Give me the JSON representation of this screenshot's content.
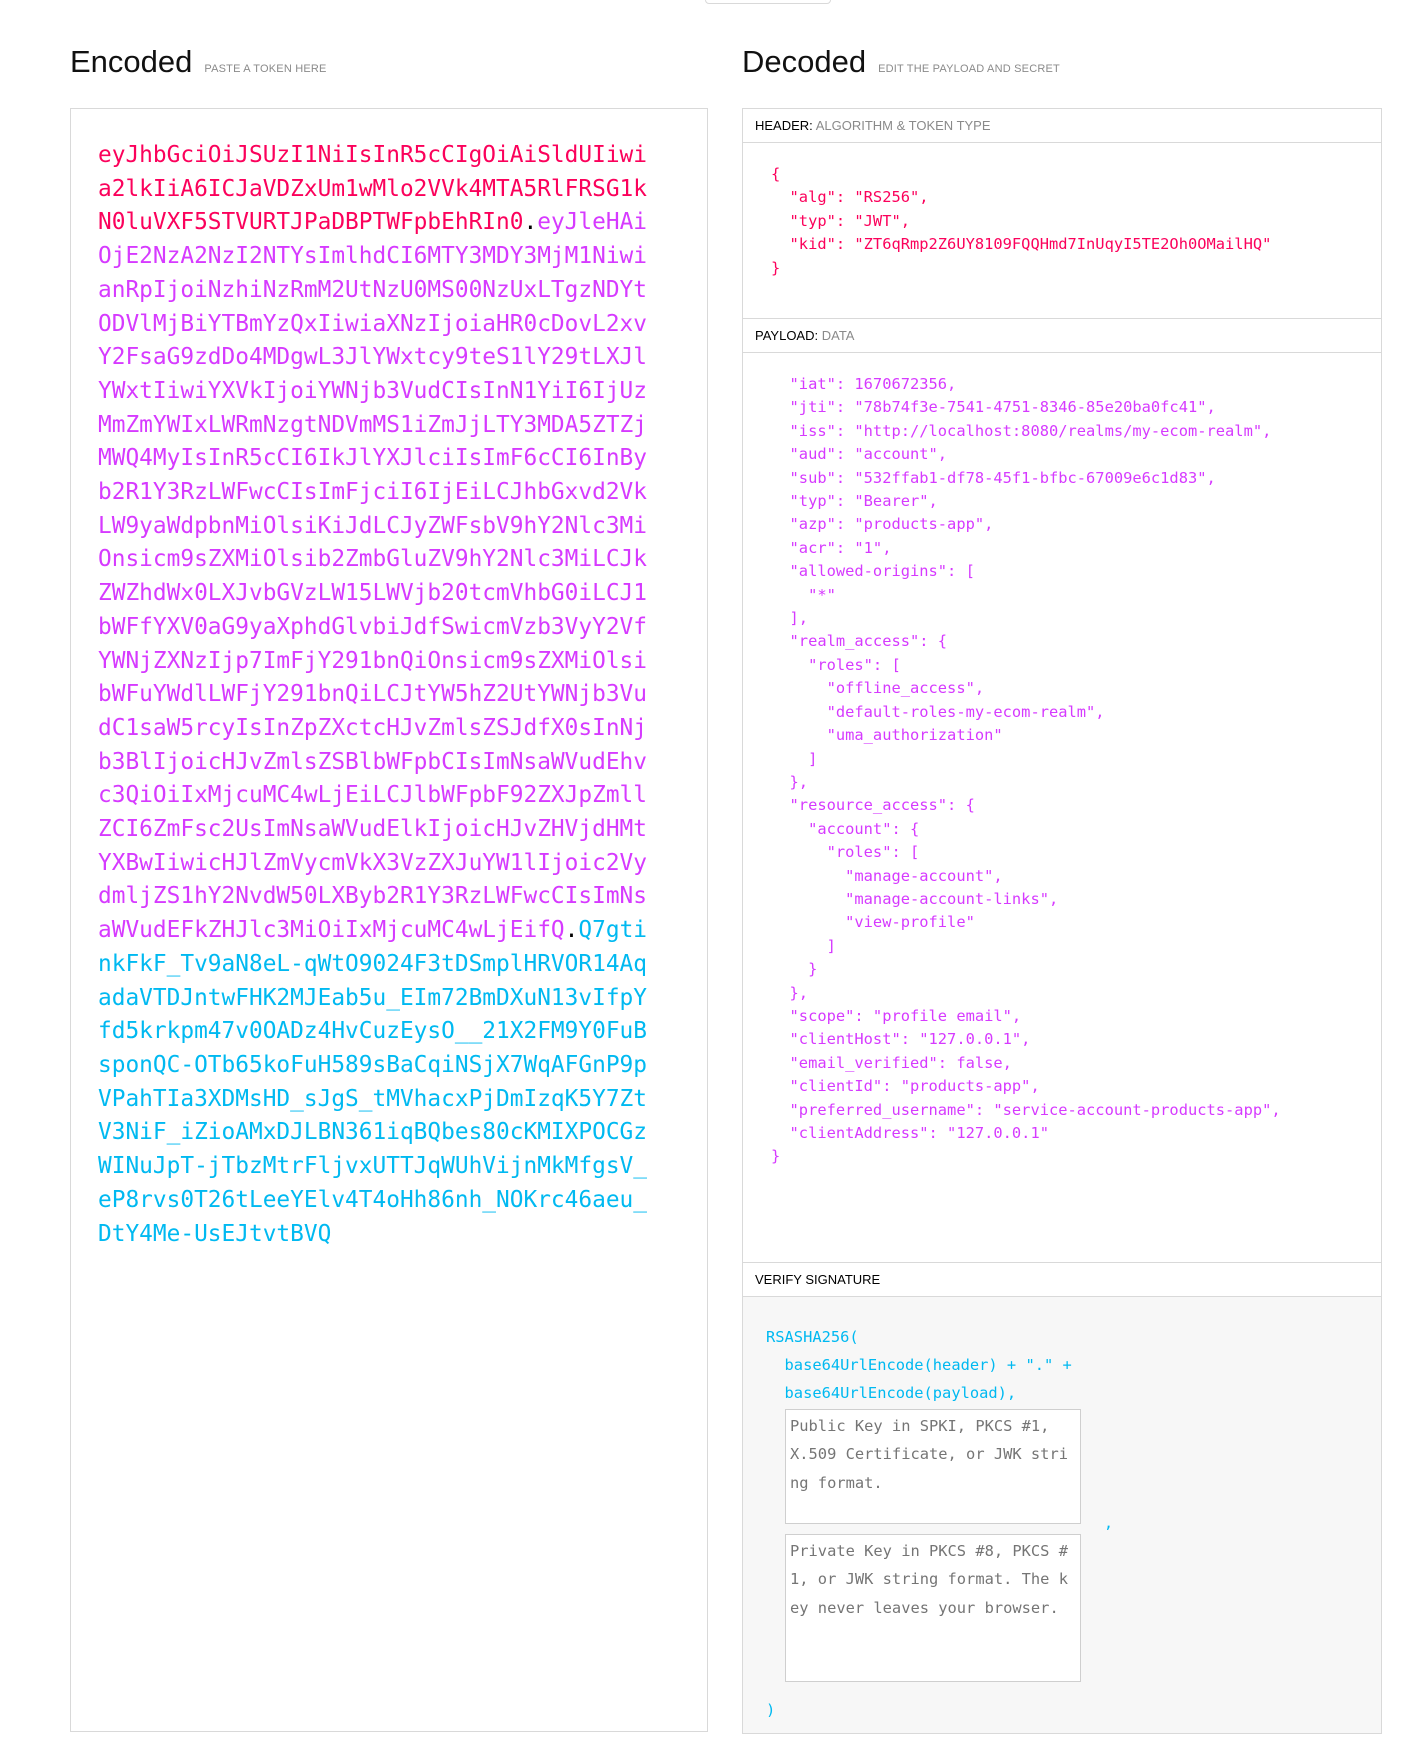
{
  "encoded": {
    "title": "Encoded",
    "subtitle": "PASTE A TOKEN HERE",
    "header_part": "eyJhbGciOiJSUzI1NiIsInR5cCIgOiAiSldUIiwia2lkIiA6ICJaVDZxUm1wMlo2VVk4MTA5RlFRSG1kN0luVXF5STVURTJPaDBPTWFpbEhRIn0",
    "payload_part": "eyJleHAiOjE2NzA2NzI2NTYsImlhdCI6MTY3MDY3MjM1NiwianRpIjoiNzhiNzRmM2UtNzU0MS00NzUxLTgzNDYtODVlMjBiYTBmYzQxIiwiaXNzIjoiaHR0cDovL2xvY2FsaG9zdDo4MDgwL3JlYWxtcy9teS1lY29tLXJlYWxtIiwiYXVkIjoiYWNjb3VudCIsInN1YiI6IjUzMmZmYWIxLWRmNzgtNDVmMS1iZmJjLTY3MDA5ZTZjMWQ4MyIsInR5cCI6IkJlYXJlciIsImF6cCI6InByb2R1Y3RzLWFwcCIsImFjciI6IjEiLCJhbGxvd2VkLW9yaWdpbnMiOlsiKiJdLCJyZWFsbV9hY2Nlc3MiOnsicm9sZXMiOlsib2ZmbGluZV9hY2Nlc3MiLCJkZWZhdWx0LXJvbGVzLW15LWVjb20tcmVhbG0iLCJ1bWFfYXV0aG9yaXphdGlvbiJdfSwicmVzb3VyY2VfYWNjZXNzIjp7ImFjY291bnQiOnsicm9sZXMiOlsibWFuYWdlLWFjY291bnQiLCJtYW5hZ2UtYWNjb3VudC1saW5rcyIsInZpZXctcHJvZmlsZSJdfX0sInNjb3BlIjoicHJvZmlsZSBlbWFpbCIsImNsaWVudEhvc3QiOiIxMjcuMC4wLjEiLCJlbWFpbF92ZXJpZmllZCI6ZmFsc2UsImNsaWVudElkIjoicHJvZHVjdHMtYXBwIiwicHJlZmVycmVkX3VzZXJuYW1lIjoic2VydmljZS1hY2NvdW50LXByb2R1Y3RzLWFwcCIsImNsaWVudEFkZHJlc3MiOiIxMjcuMC4wLjEifQ",
    "signature_part": "Q7gtinkFkF_Tv9aN8eL-qWtO9024F3tDSmplHRVOR14AqadaVTDJntwFHK2MJEab5u_EIm72BmDXuN13vIfpYfd5krkpm47v0OADz4HvCuzEysO__21X2FM9Y0FuBsponQC-OTb65koFuH589sBaCqiNSjX7WqAFGnP9pVPahTIa3XDMsHD_sJgS_tMVhacxPjDmIzqK5Y7ZtV3NiF_iZioAMxDJLBN361iqBQbes80cKMIXPOCGzWINuJpT-jTbzMtrFljvxUTTJqWUhVijnMkMfgsV_eP8rvs0T26tLeeYElv4T4oHh86nh_NOKrc46aeu_DtY4Me-UsEJtvtBVQ",
    "dot": "."
  },
  "decoded": {
    "title": "Decoded",
    "subtitle": "EDIT THE PAYLOAD AND SECRET",
    "header_label": "HEADER:",
    "header_sub": "ALGORITHM & TOKEN TYPE",
    "header_json": "{\n  \"alg\": \"RS256\",\n  \"typ\": \"JWT\",\n  \"kid\": \"ZT6qRmp2Z6UY8109FQQHmd7InUqyI5TE2Oh0OMailHQ\"\n}",
    "payload_label": "PAYLOAD:",
    "payload_sub": "DATA",
    "payload_json": "  \"iat\": 1670672356,\n  \"jti\": \"78b74f3e-7541-4751-8346-85e20ba0fc41\",\n  \"iss\": \"http://localhost:8080/realms/my-ecom-realm\",\n  \"aud\": \"account\",\n  \"sub\": \"532ffab1-df78-45f1-bfbc-67009e6c1d83\",\n  \"typ\": \"Bearer\",\n  \"azp\": \"products-app\",\n  \"acr\": \"1\",\n  \"allowed-origins\": [\n    \"*\"\n  ],\n  \"realm_access\": {\n    \"roles\": [\n      \"offline_access\",\n      \"default-roles-my-ecom-realm\",\n      \"uma_authorization\"\n    ]\n  },\n  \"resource_access\": {\n    \"account\": {\n      \"roles\": [\n        \"manage-account\",\n        \"manage-account-links\",\n        \"view-profile\"\n      ]\n    }\n  },\n  \"scope\": \"profile email\",\n  \"clientHost\": \"127.0.0.1\",\n  \"email_verified\": false,\n  \"clientId\": \"products-app\",\n  \"preferred_username\": \"service-account-products-app\",\n  \"clientAddress\": \"127.0.0.1\"\n}",
    "verify_label": "VERIFY SIGNATURE",
    "verify_line1": "RSASHA256(",
    "verify_line2": "  base64UrlEncode(header) + \".\" +",
    "verify_line3": "  base64UrlEncode(payload),",
    "public_key_placeholder": "Public Key in SPKI, PKCS #1, X.509 Certificate, or JWK string format.",
    "private_key_placeholder": "Private Key in PKCS #8, PKCS #1, or JWK string format. The key never leaves your browser.",
    "comma": ",",
    "verify_close": ")"
  },
  "colors": {
    "header": "#fb015b",
    "payload": "#d63aff",
    "signature": "#00b9f1"
  }
}
